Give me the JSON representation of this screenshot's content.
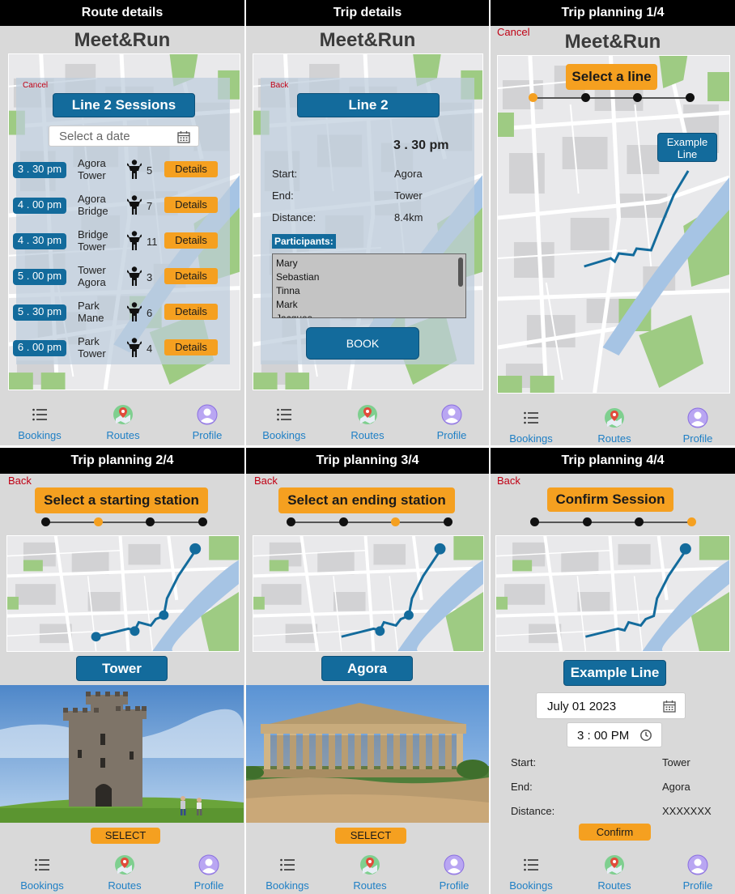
{
  "app_name": "Meet&Run",
  "screens": {
    "route_details": {
      "header": "Route details",
      "cancel": "Cancel",
      "title": "Line 2 Sessions",
      "date_placeholder": "Select a date",
      "sessions": [
        {
          "time": "3 . 30 pm",
          "from": "Agora",
          "to": "Tower",
          "count": "5",
          "action": "Details"
        },
        {
          "time": "4 . 00 pm",
          "from": "Agora",
          "to": "Bridge",
          "count": "7",
          "action": "Details"
        },
        {
          "time": "4 . 30 pm",
          "from": "Bridge",
          "to": "Tower",
          "count": "11",
          "action": "Details"
        },
        {
          "time": "5 . 00 pm",
          "from": "Tower",
          "to": "Agora",
          "count": "3",
          "action": "Details"
        },
        {
          "time": "5 . 30 pm",
          "from": "Park",
          "to": "Mane",
          "count": "6",
          "action": "Details"
        },
        {
          "time": "6 . 00 pm",
          "from": "Park",
          "to": "Tower",
          "count": "4",
          "action": "Details"
        }
      ]
    },
    "trip_details": {
      "header": "Trip details",
      "back": "Back",
      "title": "Line 2",
      "time": "3 . 30 pm",
      "start_label": "Start:",
      "start_value": "Agora",
      "end_label": "End:",
      "end_value": "Tower",
      "distance_label": "Distance:",
      "distance_value": "8.4km",
      "participants_label": "Participants:",
      "participants": [
        "Mary",
        "Sebastian",
        "Tinna",
        "Mark",
        "Jacques"
      ],
      "book": "BOOK"
    },
    "plan1": {
      "header": "Trip planning 1/4",
      "cancel": "Cancel",
      "title": "Select a line",
      "example_line": "Example Line",
      "active_step": 0
    },
    "plan2": {
      "header": "Trip planning 2/4",
      "back": "Back",
      "title": "Select a starting station",
      "station": "Tower",
      "select": "SELECT",
      "active_step": 1
    },
    "plan3": {
      "header": "Trip planning 3/4",
      "back": "Back",
      "title": "Select an ending station",
      "station": "Agora",
      "select": "SELECT",
      "active_step": 2
    },
    "plan4": {
      "header": "Trip planning 4/4",
      "back": "Back",
      "title": "Confirm Session",
      "line": "Example Line",
      "date": "July 01 2023",
      "time": "3 : 00 PM",
      "start_label": "Start:",
      "start_value": "Tower",
      "end_label": "End:",
      "end_value": "Agora",
      "distance_label": "Distance:",
      "distance_value": "XXXXXXX",
      "confirm": "Confirm",
      "active_step": 3
    }
  },
  "nav": {
    "bookings": "Bookings",
    "routes": "Routes",
    "profile": "Profile"
  },
  "colors": {
    "accent_blue": "#136b9c",
    "accent_orange": "#f5a020",
    "link_red": "#c00014",
    "nav_blue": "#1e7fc5"
  }
}
